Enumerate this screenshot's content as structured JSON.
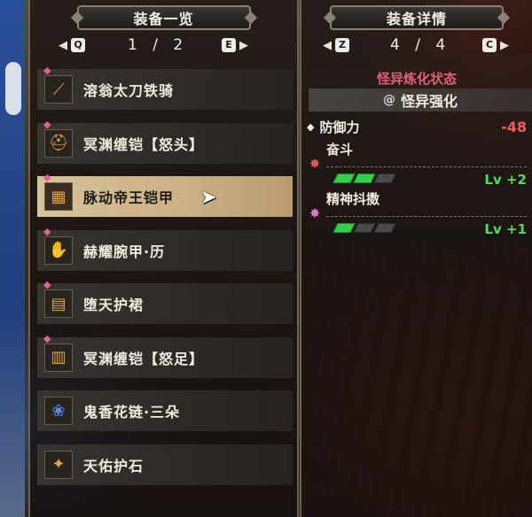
{
  "left_panel": {
    "title": "装备一览",
    "prev_key": "Q",
    "next_key": "E",
    "page": "1 / 2",
    "items": [
      {
        "name": "溶翁太刀铁骑",
        "icon": "great-sword-icon"
      },
      {
        "name": "冥渊缠铠【怒头】",
        "icon": "helm-icon"
      },
      {
        "name": "脉动帝王铠甲",
        "icon": "chest-armor-icon",
        "selected": true
      },
      {
        "name": "赫耀腕甲·历",
        "icon": "gauntlet-icon"
      },
      {
        "name": "堕天护裙",
        "icon": "waist-armor-icon"
      },
      {
        "name": "冥渊缠铠【怒足】",
        "icon": "greaves-icon"
      },
      {
        "name": "鬼香花链·三朵",
        "icon": "charm-flower-icon"
      },
      {
        "name": "天佑护石",
        "icon": "talisman-icon"
      }
    ]
  },
  "right_panel": {
    "title": "装备详情",
    "prev_key": "Z",
    "next_key": "C",
    "page": "4 / 4",
    "status_title": "怪异炼化状态",
    "status_label": "怪异强化",
    "stat": {
      "name": "防御力",
      "value": "-48"
    },
    "skills": [
      {
        "name": "奋斗",
        "level_text": "Lv +2",
        "level": 2,
        "max": 3,
        "icon_color": "#e05a5a"
      },
      {
        "name": "精神抖擞",
        "level_text": "Lv +1",
        "level": 1,
        "max": 3,
        "icon_color": "#e07ac8"
      }
    ]
  },
  "colors": {
    "accent_pink": "#e2607e",
    "negative_red": "#f0605a",
    "level_green": "#4ce05a",
    "selected_bg": "#d8c29a"
  }
}
